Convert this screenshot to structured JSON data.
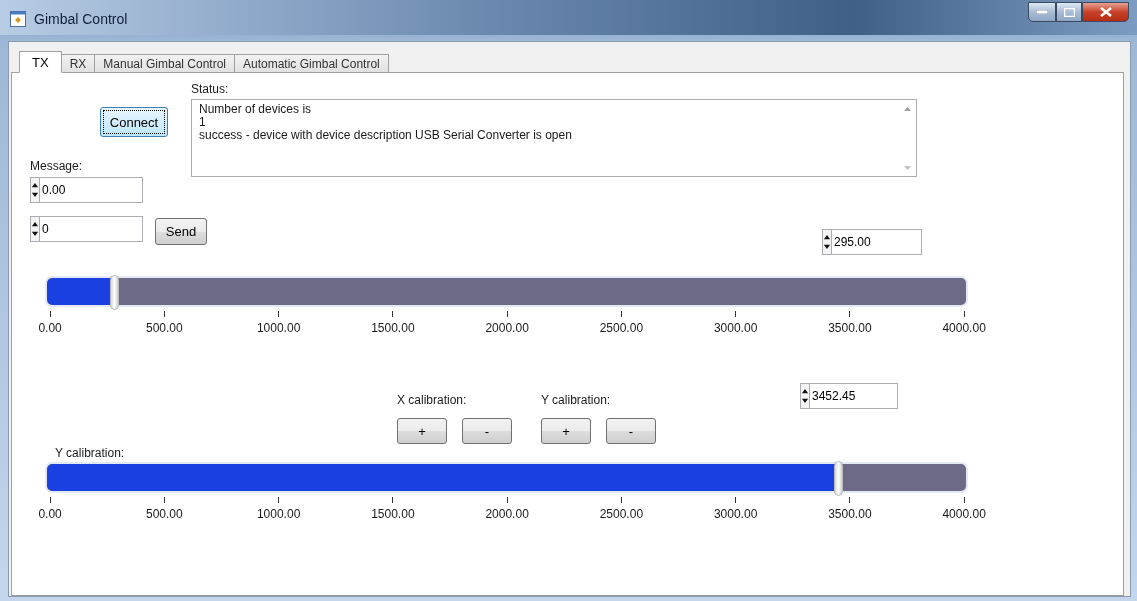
{
  "window": {
    "title": "Gimbal Control"
  },
  "tabs": [
    {
      "label": "TX",
      "selected": true
    },
    {
      "label": "RX",
      "selected": false
    },
    {
      "label": "Manual Gimbal Control",
      "selected": false
    },
    {
      "label": "Automatic Gimbal Control",
      "selected": false
    }
  ],
  "connect_button": {
    "label": "Connect",
    "focused": true
  },
  "status": {
    "label": "Status:",
    "lines": [
      "Number of devices is",
      "1",
      "success - device with device description USB Serial Converter is open"
    ]
  },
  "message": {
    "label": "Message:",
    "value_spinner": "0.00",
    "count_spinner": "0",
    "send_button": "Send"
  },
  "position_spinner": "295.00",
  "sliders": [
    {
      "level": 0.074,
      "ticks": [
        "0.00",
        "500.00",
        "1000.00",
        "1500.00",
        "2000.00",
        "2500.00",
        "3000.00",
        "3500.00",
        "4000.00"
      ]
    },
    {
      "level": 0.862,
      "ticks": [
        "0.00",
        "500.00",
        "1000.00",
        "1500.00",
        "2000.00",
        "2500.00",
        "3000.00",
        "3500.00",
        "4000.00"
      ]
    }
  ],
  "calibration": {
    "groups": [
      {
        "label": "X calibration:",
        "buttons": [
          "+",
          "-"
        ]
      },
      {
        "label": "Y calibration:",
        "buttons": [
          "+",
          "-"
        ]
      }
    ],
    "spinner": "3452.45",
    "slider_label": "Y calibration:"
  }
}
